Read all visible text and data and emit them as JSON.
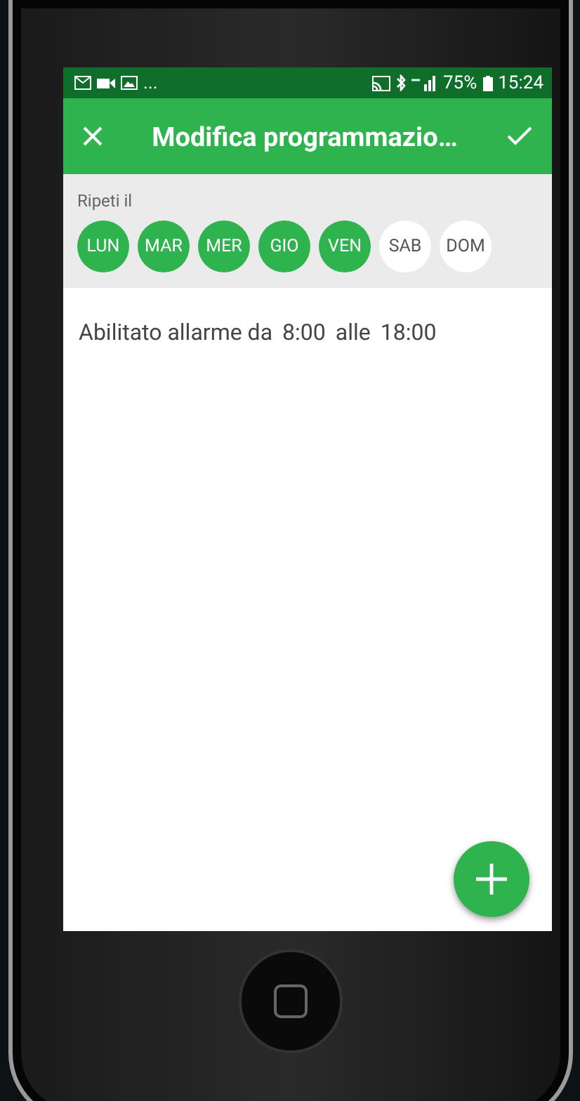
{
  "status_bar": {
    "overflow": "...",
    "battery": "75%",
    "time": "15:24"
  },
  "toolbar": {
    "title": "Modifica programmazio…"
  },
  "repeat": {
    "label": "Ripeti il",
    "days": [
      {
        "label": "LUN",
        "selected": true
      },
      {
        "label": "MAR",
        "selected": true
      },
      {
        "label": "MER",
        "selected": true
      },
      {
        "label": "GIO",
        "selected": true
      },
      {
        "label": "VEN",
        "selected": true
      },
      {
        "label": "SAB",
        "selected": false
      },
      {
        "label": "DOM",
        "selected": false
      }
    ]
  },
  "schedule": {
    "text": "Abilitato allarme da",
    "start": "8:00",
    "joiner": "alle",
    "end": "18:00"
  }
}
